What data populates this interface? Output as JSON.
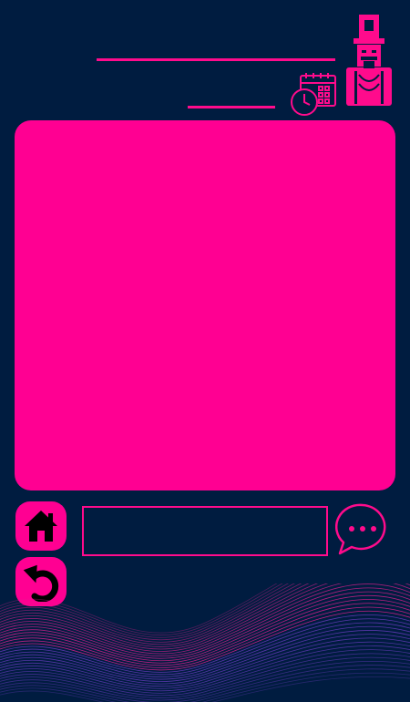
{
  "colors": {
    "background": "#001c40",
    "accent": "#ff0092",
    "wave_pink": "#e0208f",
    "wave_purple": "#6a3cc0"
  },
  "header": {
    "decoration_icon": "nutcracker-icon",
    "schedule_icon": "calendar-clock-icon"
  },
  "controls": {
    "home_icon": "home-icon",
    "back_icon": "undo-arrow-icon",
    "chat_icon": "speech-bubble-ellipsis-icon",
    "chat_input_value": "",
    "chat_input_placeholder": ""
  }
}
